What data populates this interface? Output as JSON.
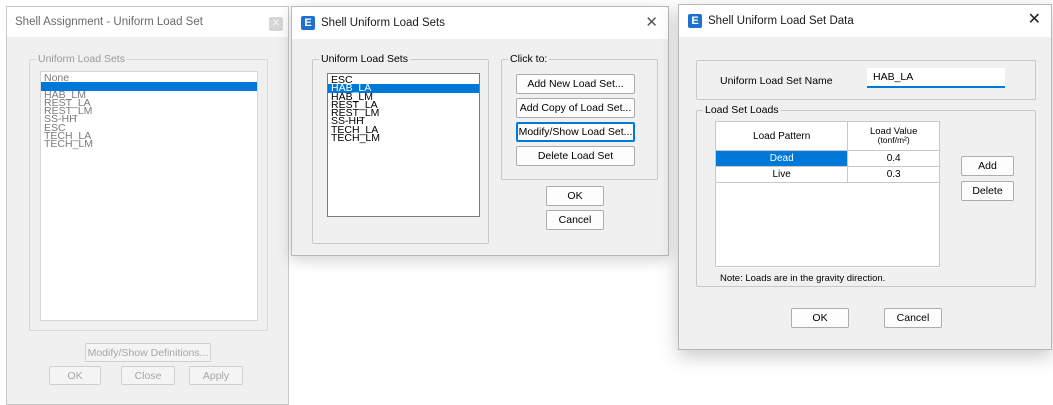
{
  "win1": {
    "title": "Shell Assignment - Uniform Load Set",
    "group_label": "Uniform Load Sets",
    "items": [
      "None",
      "HAB_LA",
      "HAB_LM",
      "REST_LA",
      "REST_LM",
      "SS-HH",
      "ESC",
      "TECH_LA",
      "TECH_LM"
    ],
    "selected": "HAB_LA",
    "modify_label": "Modify/Show Definitions...",
    "ok_label": "OK",
    "close_label": "Close",
    "apply_label": "Apply"
  },
  "win2": {
    "title": "Shell Uniform Load Sets",
    "list_label": "Uniform Load Sets",
    "items": [
      "ESC",
      "HAB_LA",
      "HAB_LM",
      "REST_LA",
      "REST_LM",
      "SS-HH",
      "TECH_LA",
      "TECH_LM"
    ],
    "selected": "HAB_LA",
    "clickto_label": "Click to:",
    "add_new": "Add New Load Set...",
    "add_copy": "Add Copy of Load Set...",
    "modify": "Modify/Show Load Set...",
    "delete": "Delete Load Set",
    "ok": "OK",
    "cancel": "Cancel"
  },
  "win3": {
    "title": "Shell Uniform Load Set Data",
    "name_label": "Uniform Load Set Name",
    "name_value": "HAB_LA",
    "loads_label": "Load Set Loads",
    "col_pattern": "Load Pattern",
    "col_value": "Load Value",
    "col_units": "(tonf/m²)",
    "rows": [
      {
        "pattern": "Dead",
        "value": "0.4"
      },
      {
        "pattern": "Live",
        "value": "0.3"
      }
    ],
    "add": "Add",
    "delete": "Delete",
    "note": "Note:  Loads are in the gravity direction.",
    "ok": "OK",
    "cancel": "Cancel"
  },
  "colors": {
    "accent": "#0078d7",
    "app_icon": "#1e6fd0"
  },
  "icons": {
    "app": "etabs-app-icon",
    "close": "close-icon"
  }
}
